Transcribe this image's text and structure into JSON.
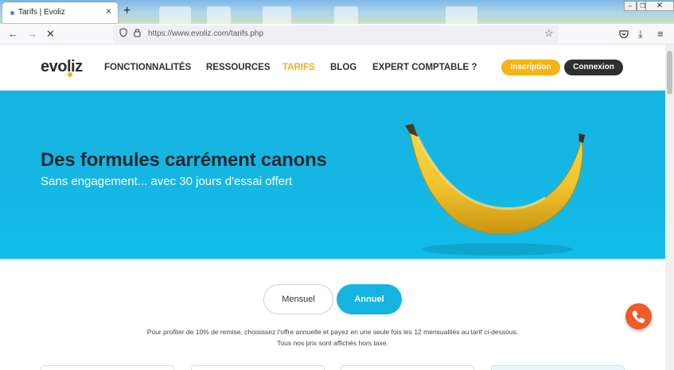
{
  "browser": {
    "tab_title": "Tarifs | Evoliz",
    "tab_close": "×",
    "new_tab": "+",
    "url": "https://www.evoliz.com/tarifs.php",
    "window_controls": {
      "minimize": "–",
      "restore": "❐",
      "close": "✕"
    },
    "toolbar_icons": [
      "back-icon",
      "forward-icon",
      "stop-loading-icon",
      "shield-icon",
      "lock-icon",
      "bookmark-star-icon",
      "pocket-icon",
      "download-icon",
      "menu-icon"
    ]
  },
  "site": {
    "logo": "evoliz",
    "nav": [
      "FONCTIONNALITÉS",
      "RESSOURCES",
      "TARIFS",
      "BLOG",
      "EXPERT COMPTABLE ?"
    ],
    "active_nav": "TARIFS",
    "inscription_label": "Inscription",
    "connexion_label": "Connexion"
  },
  "hero": {
    "title": "Des formules carrément canons",
    "subtitle": "Sans engagement... avec 30 jours d'essai offert"
  },
  "pricing": {
    "toggle_monthly": "Mensuel",
    "toggle_annual": "Annuel",
    "selected": "Annuel",
    "info_line1": "Pour profiter de 10% de remise, choisissez l'offre annuelle et payez en une seule fois les 12 mensualités au tarif ci-dessous.",
    "info_line2": "Tous nos prix sont affichés hors taxe."
  },
  "colors": {
    "brand_yellow": "#f5b317",
    "hero_blue": "#15b7e4",
    "dark": "#2f2f2f",
    "phone_orange": "#f15a2b"
  }
}
